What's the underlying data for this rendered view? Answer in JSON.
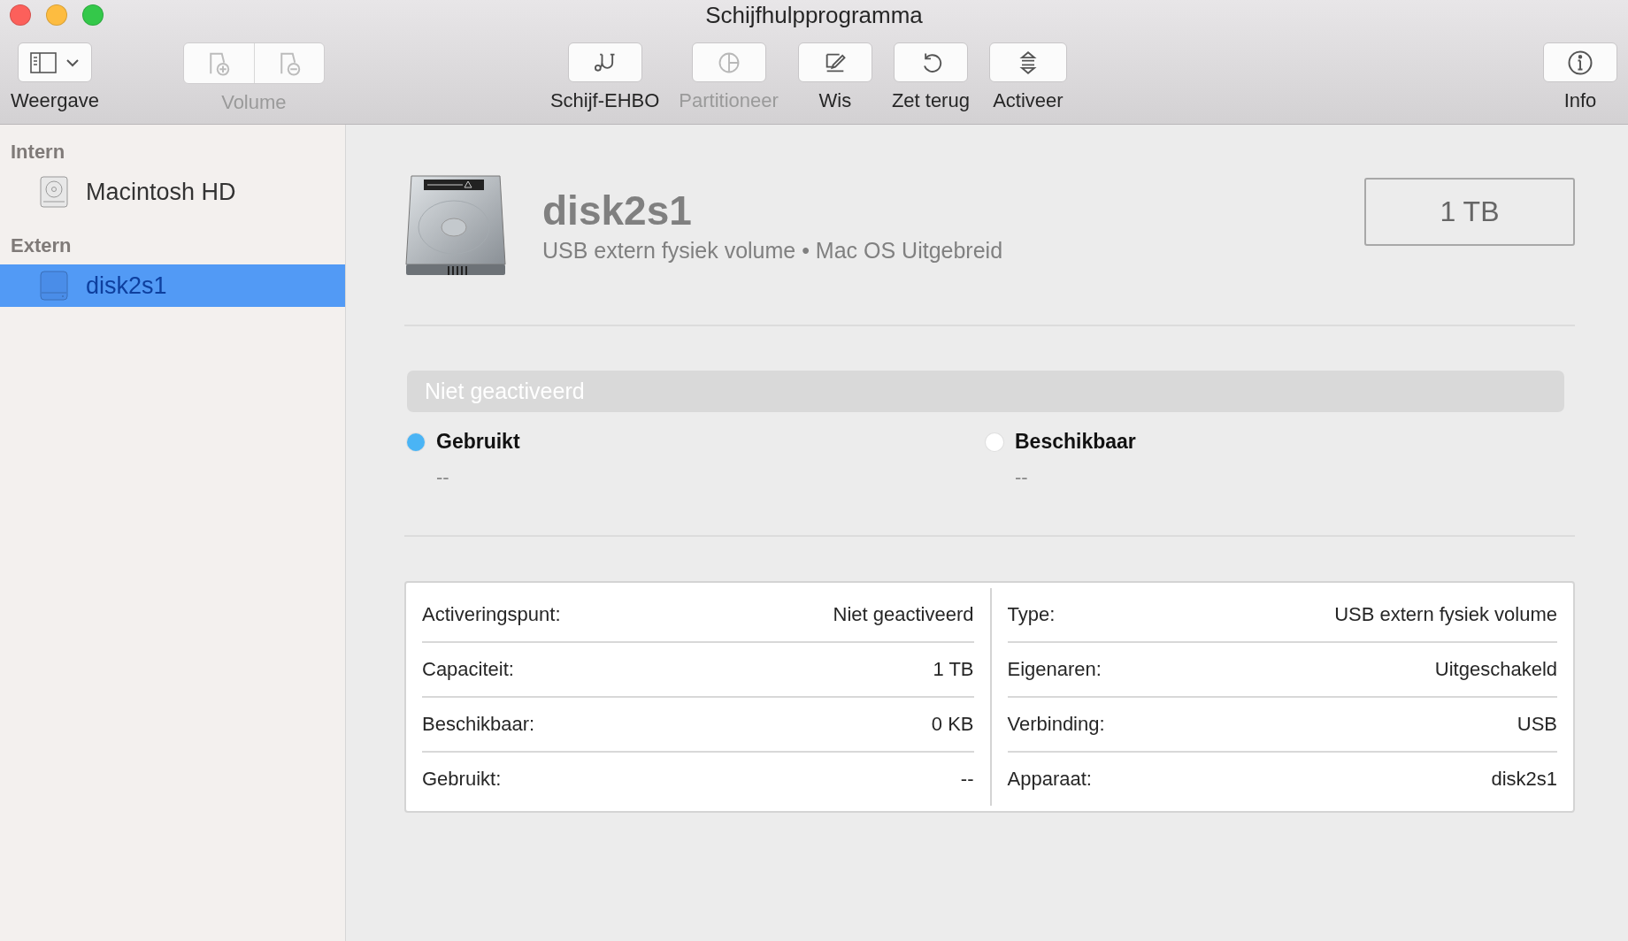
{
  "window": {
    "title": "Schijfhulpprogramma"
  },
  "toolbar": [
    {
      "kind": "view",
      "label": "Weergave",
      "disabled": false
    },
    {
      "kind": "segmented",
      "label": "Volume",
      "disabled": true
    },
    {
      "kind": "first-aid",
      "label": "Schijf-EHBO",
      "disabled": false
    },
    {
      "kind": "partition",
      "label": "Partitioneer",
      "disabled": true
    },
    {
      "kind": "erase",
      "label": "Wis",
      "disabled": false
    },
    {
      "kind": "restore",
      "label": "Zet terug",
      "disabled": false
    },
    {
      "kind": "mount",
      "label": "Activeer",
      "disabled": false
    },
    {
      "kind": "info",
      "label": "Info",
      "disabled": false
    }
  ],
  "sidebar": {
    "sections": [
      {
        "title": "Intern",
        "items": [
          {
            "label": "Macintosh HD",
            "kind": "internal",
            "selected": false
          }
        ]
      },
      {
        "title": "Extern",
        "items": [
          {
            "label": "disk2s1",
            "kind": "external",
            "selected": true
          }
        ]
      }
    ]
  },
  "volume": {
    "name": "disk2s1",
    "subtitle": "USB extern fysiek volume • Mac OS Uitgebreid",
    "capacity": "1 TB"
  },
  "usage": {
    "status": "Niet geactiveerd",
    "legend": [
      {
        "label": "Gebruikt",
        "value": "--",
        "color": "#4ab4f5"
      },
      {
        "label": "Beschikbaar",
        "value": "--",
        "color": "#ffffff"
      }
    ]
  },
  "details": {
    "left": [
      {
        "label": "Activeringspunt:",
        "value": "Niet geactiveerd"
      },
      {
        "label": "Capaciteit:",
        "value": "1 TB"
      },
      {
        "label": "Beschikbaar:",
        "value": "0 KB"
      },
      {
        "label": "Gebruikt:",
        "value": "--"
      }
    ],
    "right": [
      {
        "label": "Type:",
        "value": "USB extern fysiek volume"
      },
      {
        "label": "Eigenaren:",
        "value": "Uitgeschakeld"
      },
      {
        "label": "Verbinding:",
        "value": "USB"
      },
      {
        "label": "Apparaat:",
        "value": "disk2s1"
      }
    ]
  }
}
